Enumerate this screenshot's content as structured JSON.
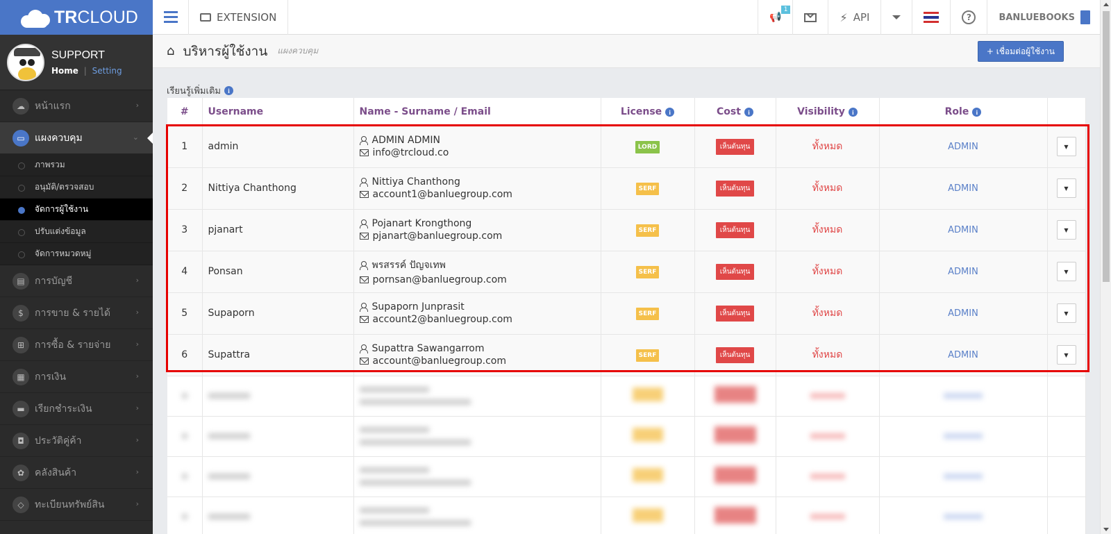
{
  "brand": {
    "bold": "TR",
    "light": "CLOUD"
  },
  "profile": {
    "name": "SUPPORT",
    "home": "Home",
    "sep": "|",
    "setting": "Setting"
  },
  "nav": [
    {
      "label": "หน้าแรก",
      "icon": "☁",
      "icon_name": "cloud-icon"
    },
    {
      "label": "แผงควบคุม",
      "icon": "▭",
      "icon_name": "monitor-icon",
      "active": true
    },
    {
      "label": "การบัญชี",
      "icon": "▤",
      "icon_name": "book-icon"
    },
    {
      "label": "การขาย & รายได้",
      "icon": "$",
      "icon_name": "dollar-icon"
    },
    {
      "label": "การซื้อ & รายจ่าย",
      "icon": "⊞",
      "icon_name": "cart-icon"
    },
    {
      "label": "การเงิน",
      "icon": "▦",
      "icon_name": "calendar-icon"
    },
    {
      "label": "เรียกชำระเงิน",
      "icon": "▬",
      "icon_name": "card-icon"
    },
    {
      "label": "ประวัติคู่ค้า",
      "icon": "◘",
      "icon_name": "contact-icon"
    },
    {
      "label": "คลังสินค้า",
      "icon": "✿",
      "icon_name": "boxes-icon"
    },
    {
      "label": "ทะเบียนทรัพย์สิน",
      "icon": "◇",
      "icon_name": "diamond-icon"
    }
  ],
  "subnav": [
    {
      "label": "ภาพรวม"
    },
    {
      "label": "อนุมัติ/ตรวจสอบ"
    },
    {
      "label": "จัดการผู้ใช้งาน",
      "active": true
    },
    {
      "label": "ปรับแต่งข้อมูล"
    },
    {
      "label": "จัดการหมวดหมู่"
    }
  ],
  "topbar": {
    "extension": "EXTENSION",
    "badge": "1",
    "api": "API",
    "company": "BANLUEBOOKS",
    "help": "?"
  },
  "page": {
    "title": "บริหารผู้ใช้งาน",
    "subtitle": "แผงควบคุม",
    "connect_button": "+ เชื่อมต่อผู้ใช้งาน",
    "learn_more": "เรียนรู้เพิ่มเติม"
  },
  "table": {
    "headers": {
      "num": "#",
      "username": "Username",
      "name_email": "Name - Surname / Email",
      "license": "License",
      "cost": "Cost",
      "visibility": "Visibility",
      "role": "Role"
    },
    "rows": [
      {
        "num": "1",
        "username": "admin",
        "name": "ADMIN ADMIN",
        "email": "info@trcloud.co",
        "license": "LORD",
        "license_color": "#8bc34a",
        "cost": "เห็นต้นทุน",
        "visibility": "ทั้งหมด",
        "role": "ADMIN"
      },
      {
        "num": "2",
        "username": "Nittiya Chanthong",
        "name": "Nittiya Chanthong",
        "email": "account1@banluegroup.com",
        "license": "SERF",
        "license_color": "#f5c04a",
        "cost": "เห็นต้นทุน",
        "visibility": "ทั้งหมด",
        "role": "ADMIN"
      },
      {
        "num": "3",
        "username": "pjanart",
        "name": "Pojanart Krongthong",
        "email": "pjanart@banluegroup.com",
        "license": "SERF",
        "license_color": "#f5c04a",
        "cost": "เห็นต้นทุน",
        "visibility": "ทั้งหมด",
        "role": "ADMIN"
      },
      {
        "num": "4",
        "username": "Ponsan",
        "name": "พรสรรค์ ปัญจเทพ",
        "email": "pornsan@banluegroup.com",
        "license": "SERF",
        "license_color": "#f5c04a",
        "cost": "เห็นต้นทุน",
        "visibility": "ทั้งหมด",
        "role": "ADMIN"
      },
      {
        "num": "5",
        "username": "Supaporn",
        "name": "Supaporn Junprasit",
        "email": "account2@banluegroup.com",
        "license": "SERF",
        "license_color": "#f5c04a",
        "cost": "เห็นต้นทุน",
        "visibility": "ทั้งหมด",
        "role": "ADMIN"
      },
      {
        "num": "6",
        "username": "Supattra",
        "name": "Supattra Sawangarrom",
        "email": "account@banluegroup.com",
        "license": "SERF",
        "license_color": "#f5c04a",
        "cost": "เห็นต้นทุน",
        "visibility": "ทั้งหมด",
        "role": "ADMIN"
      }
    ],
    "blurred_rows": 4
  },
  "colors": {
    "accent": "#4a76c7",
    "danger": "#e04848",
    "highlight": "#e60000"
  }
}
